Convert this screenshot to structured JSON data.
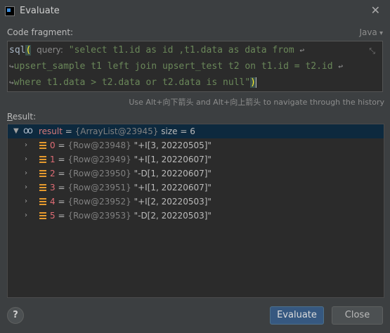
{
  "window": {
    "title": "Evaluate",
    "close_glyph": "✕"
  },
  "code_fragment": {
    "label": "Code fragment:",
    "language": "Java",
    "lines": {
      "l1_prefix": "sql",
      "l1_hint": "query:",
      "l1_string": "\"select  t1.id as id ,t1.data as data from",
      "l2_string": "upsert_sample t1 left join upsert_test t2 on t1.id = t2.id",
      "l3_string": "where t1.data > t2.data or t2.data is null\""
    }
  },
  "nav_hint": "Use Alt+向下箭头 and Alt+向上箭头 to navigate through the history",
  "result": {
    "label": "Result:",
    "root": {
      "name": "result",
      "ref": "{ArrayList@23945}",
      "size_text": "size = 6"
    },
    "rows": [
      {
        "index": "0",
        "ref": "{Row@23948}",
        "value": "\"+I[3, 20220505]\""
      },
      {
        "index": "1",
        "ref": "{Row@23949}",
        "value": "\"+I[1, 20220607]\""
      },
      {
        "index": "2",
        "ref": "{Row@23950}",
        "value": "\"-D[1, 20220607]\""
      },
      {
        "index": "3",
        "ref": "{Row@23951}",
        "value": "\"+I[1, 20220607]\""
      },
      {
        "index": "4",
        "ref": "{Row@23952}",
        "value": "\"+I[2, 20220503]\""
      },
      {
        "index": "5",
        "ref": "{Row@23953}",
        "value": "\"-D[2, 20220503]\""
      }
    ]
  },
  "buttons": {
    "help": "?",
    "evaluate": "Evaluate",
    "close": "Close"
  },
  "icons": {
    "app": "intellij-icon",
    "glasses": "watch-glasses-icon",
    "field": "field-icon",
    "collapse": "collapse-icon"
  },
  "colors": {
    "accent_button": "#365880",
    "selected_row": "#0d293e",
    "string": "#6a8759",
    "field_icon": "#e59a2e"
  }
}
